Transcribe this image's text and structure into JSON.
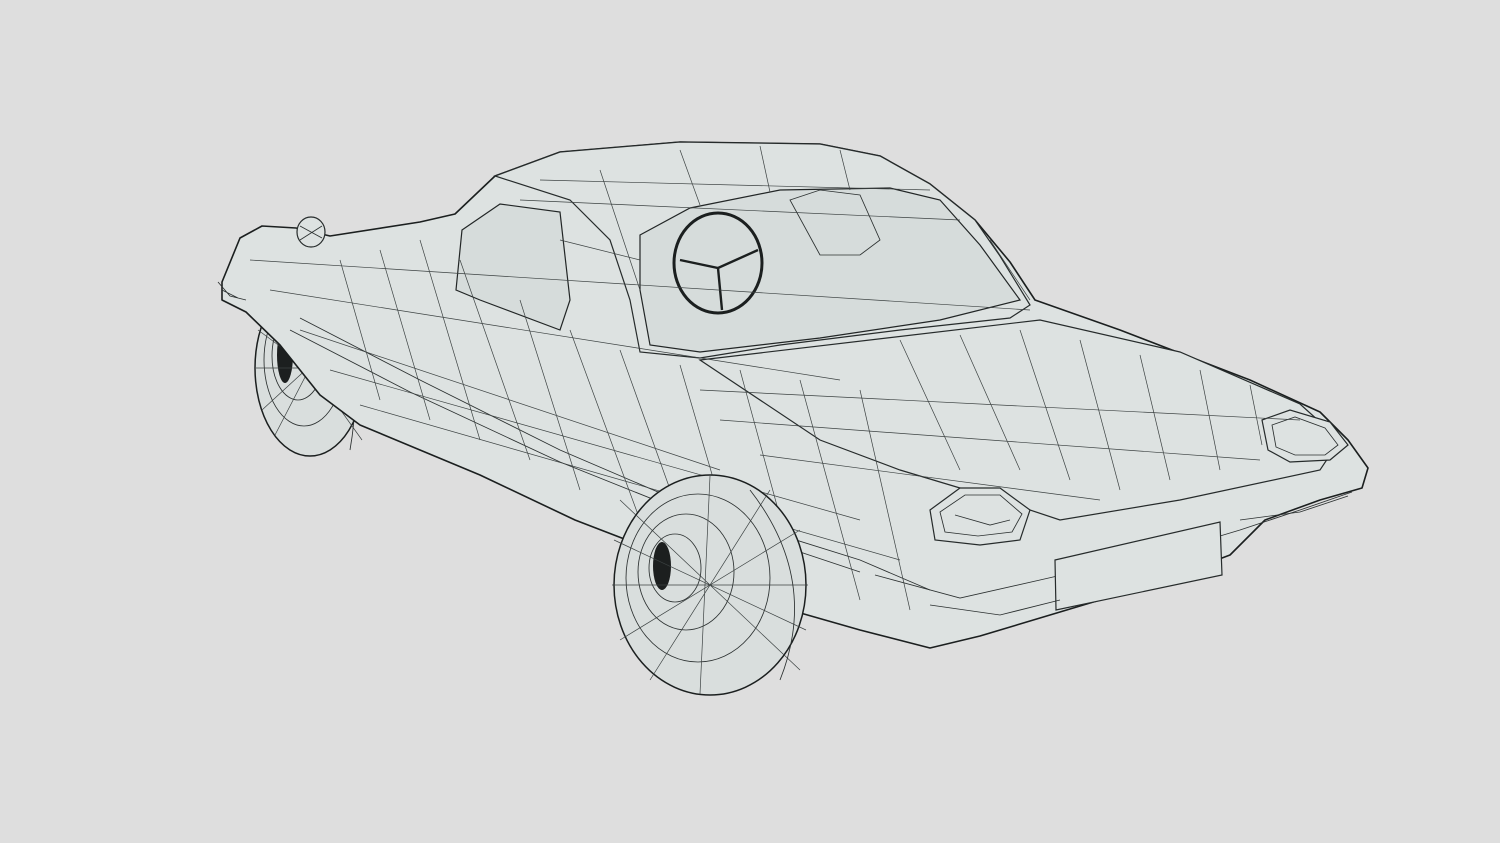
{
  "viewport": {
    "background": "#dedede",
    "mesh_fill": "#dde2e1",
    "wire_color": "#2b3030"
  },
  "model": {
    "subject": "wireframe-car-mesh",
    "view": "rear-three-quarter",
    "render_mode": "wireframe-shaded"
  }
}
